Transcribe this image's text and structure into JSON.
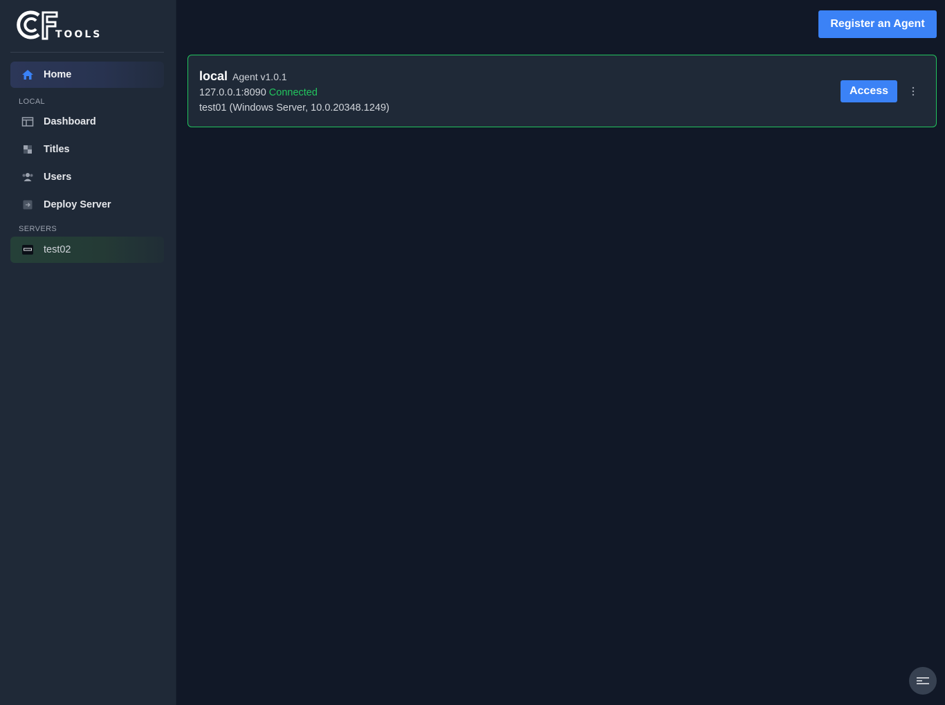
{
  "brand": {
    "logo_text": "TOOLS"
  },
  "sidebar": {
    "home": {
      "label": "Home",
      "icon": "home-icon"
    },
    "local_section": "LOCAL",
    "local_items": [
      {
        "label": "Dashboard",
        "icon": "dashboard-icon"
      },
      {
        "label": "Titles",
        "icon": "titles-icon"
      },
      {
        "label": "Users",
        "icon": "users-icon"
      },
      {
        "label": "Deploy Server",
        "icon": "deploy-server-icon"
      }
    ],
    "servers_section": "SERVERS",
    "servers": [
      {
        "label": "test02",
        "icon": "server-game-icon"
      }
    ]
  },
  "header": {
    "register_label": "Register an Agent"
  },
  "agent": {
    "name": "local",
    "version": "Agent v1.0.1",
    "address": "127.0.0.1:8090",
    "status": "Connected",
    "host": "test01 (Windows Server, 10.0.20348.1249)",
    "access_label": "Access",
    "menu_icon": "more-vertical-icon"
  },
  "fab": {
    "icon": "menu-lines-icon"
  },
  "colors": {
    "accent": "#3b82f6",
    "connected": "#22c55e",
    "background": "#111827",
    "sidebar": "#1f2937"
  }
}
